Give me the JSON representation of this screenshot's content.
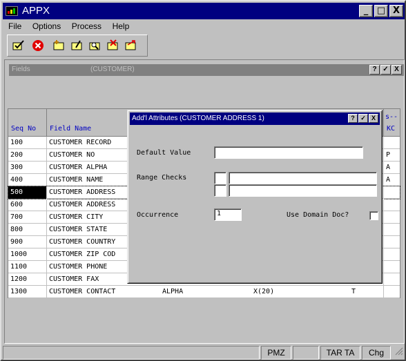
{
  "app": {
    "title": "APPX",
    "minimize": "_",
    "maximize": "□",
    "close": "X"
  },
  "menu": [
    "File",
    "Options",
    "Process",
    "Help"
  ],
  "toolbar": {
    "icons": [
      "confirm-icon",
      "cancel-icon",
      "add-icon",
      "change-icon",
      "inquire-icon",
      "delete-icon",
      "redo-icon"
    ]
  },
  "child": {
    "title": "Fields",
    "subtitle": "(CUSTOMER)",
    "help": "?",
    "ok": "✓",
    "close": "X"
  },
  "grid": {
    "headers": {
      "seq": "Seq No",
      "name": "Field Name",
      "kc_top": "s--",
      "kc": "KC"
    },
    "rows": [
      {
        "seq": "100",
        "name": "CUSTOMER RECORD",
        "type": "",
        "fmt": "",
        "t": "",
        "kc": ""
      },
      {
        "seq": "200",
        "name": "CUSTOMER NO",
        "type": "",
        "fmt": "",
        "t": "",
        "kc": "P"
      },
      {
        "seq": "300",
        "name": "CUSTOMER ALPHA",
        "type": "",
        "fmt": "",
        "t": "",
        "kc": "A"
      },
      {
        "seq": "400",
        "name": "CUSTOMER NAME",
        "type": "",
        "fmt": "",
        "t": "",
        "kc": "A"
      },
      {
        "seq": "500",
        "name": "CUSTOMER ADDRESS",
        "type": "",
        "fmt": "",
        "t": "",
        "kc": ""
      },
      {
        "seq": "600",
        "name": "CUSTOMER ADDRESS",
        "type": "",
        "fmt": "",
        "t": "",
        "kc": ""
      },
      {
        "seq": "700",
        "name": "CUSTOMER CITY",
        "type": "",
        "fmt": "",
        "t": "",
        "kc": ""
      },
      {
        "seq": "800",
        "name": "CUSTOMER STATE",
        "type": "",
        "fmt": "",
        "t": "",
        "kc": ""
      },
      {
        "seq": "900",
        "name": "CUSTOMER COUNTRY",
        "type": "",
        "fmt": "",
        "t": "",
        "kc": ""
      },
      {
        "seq": "1000",
        "name": "CUSTOMER ZIP COD",
        "type": "",
        "fmt": "",
        "t": "",
        "kc": ""
      },
      {
        "seq": "1100",
        "name": "CUSTOMER PHONE",
        "type": "",
        "fmt": "",
        "t": "",
        "kc": ""
      },
      {
        "seq": "1200",
        "name": "CUSTOMER FAX",
        "type": "",
        "fmt": "",
        "t": "",
        "kc": ""
      },
      {
        "seq": "1300",
        "name": "CUSTOMER CONTACT",
        "type": "ALPHA",
        "fmt": "X(20)",
        "t": "T",
        "kc": ""
      }
    ],
    "selected_index": 4
  },
  "dialog": {
    "title": "Add'l Attributes (CUSTOMER ADDRESS 1)",
    "help": "?",
    "ok": "✓",
    "close": "X",
    "default_value_label": "Default Value",
    "default_value": "",
    "range_checks_label": "Range Checks",
    "range1_flag": "",
    "range1_value": "",
    "range2_flag": "",
    "range2_value": "",
    "occurrence_label": "Occurrence",
    "occurrence_value": "1",
    "use_domain_doc_label": "Use Domain Doc?",
    "use_domain_doc_checked": false
  },
  "status": {
    "pmz": "PMZ",
    "tar": "TAR TA",
    "chg": "Chg"
  }
}
